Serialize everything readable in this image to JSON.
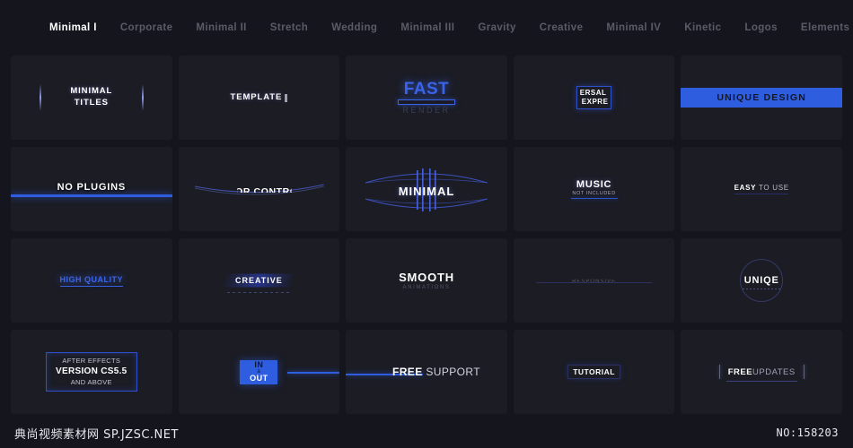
{
  "nav": {
    "items": [
      {
        "label": "Minimal I",
        "active": true
      },
      {
        "label": "Corporate",
        "active": false
      },
      {
        "label": "Minimal II",
        "active": false
      },
      {
        "label": "Stretch",
        "active": false
      },
      {
        "label": "Wedding",
        "active": false
      },
      {
        "label": "Minimal III",
        "active": false
      },
      {
        "label": "Gravity",
        "active": false
      },
      {
        "label": "Creative",
        "active": false
      },
      {
        "label": "Minimal IV",
        "active": false
      },
      {
        "label": "Kinetic",
        "active": false
      },
      {
        "label": "Logos",
        "active": false
      },
      {
        "label": "Elements",
        "active": false
      }
    ]
  },
  "cards": {
    "c1": {
      "line1": "MINIMAL",
      "line2": "TITLES"
    },
    "c2": {
      "line1": "TEMPLATE"
    },
    "c3": {
      "line1": "FAST",
      "line2": "RENDER"
    },
    "c4": {
      "line1": "ERSAL",
      "line2": "EXPRE"
    },
    "c5": {
      "line1": "UNIQUE DESIGN"
    },
    "c6": {
      "line1": "NO PLUGINS"
    },
    "c7": {
      "line1": "COLOR CONTROL"
    },
    "c8": {
      "line1": "MINIMAL"
    },
    "c9": {
      "line1": "MUSIC",
      "line2": "NOT INCLUDED"
    },
    "c10": {
      "strong": "EASY",
      "rest": " TO USE"
    },
    "c11": {
      "line1": "HIGH QUALITY"
    },
    "c12": {
      "line1": "CREATIVE"
    },
    "c13": {
      "line1": "SMOOTH",
      "line2": "ANIMATIONS"
    },
    "c14": {
      "line1": "RESPONSIVE"
    },
    "c15": {
      "line1": "UNIQE"
    },
    "c16": {
      "line1": "AFTER EFFECTS",
      "line2": "VERSION CS5.5",
      "line3": "AND ABOVE"
    },
    "c17": {
      "line1": "IN",
      "line2": "&",
      "line3": "OUT"
    },
    "c18": {
      "strong": "FREE",
      "rest": " SUPPORT"
    },
    "c19": {
      "line1": "TUTORIAL"
    },
    "c20": {
      "strong": "FREE",
      "rest": "UPDATES"
    }
  },
  "footer": {
    "watermark": "典尚视频素材网 SP.JZSC.NET",
    "id": "NO:158203"
  },
  "colors": {
    "page_bg": "#15161d",
    "card_bg": "#1b1c24",
    "accent_blue": "#2f5de0",
    "nav_inactive": "#5a5b67",
    "nav_active": "#ffffff"
  }
}
